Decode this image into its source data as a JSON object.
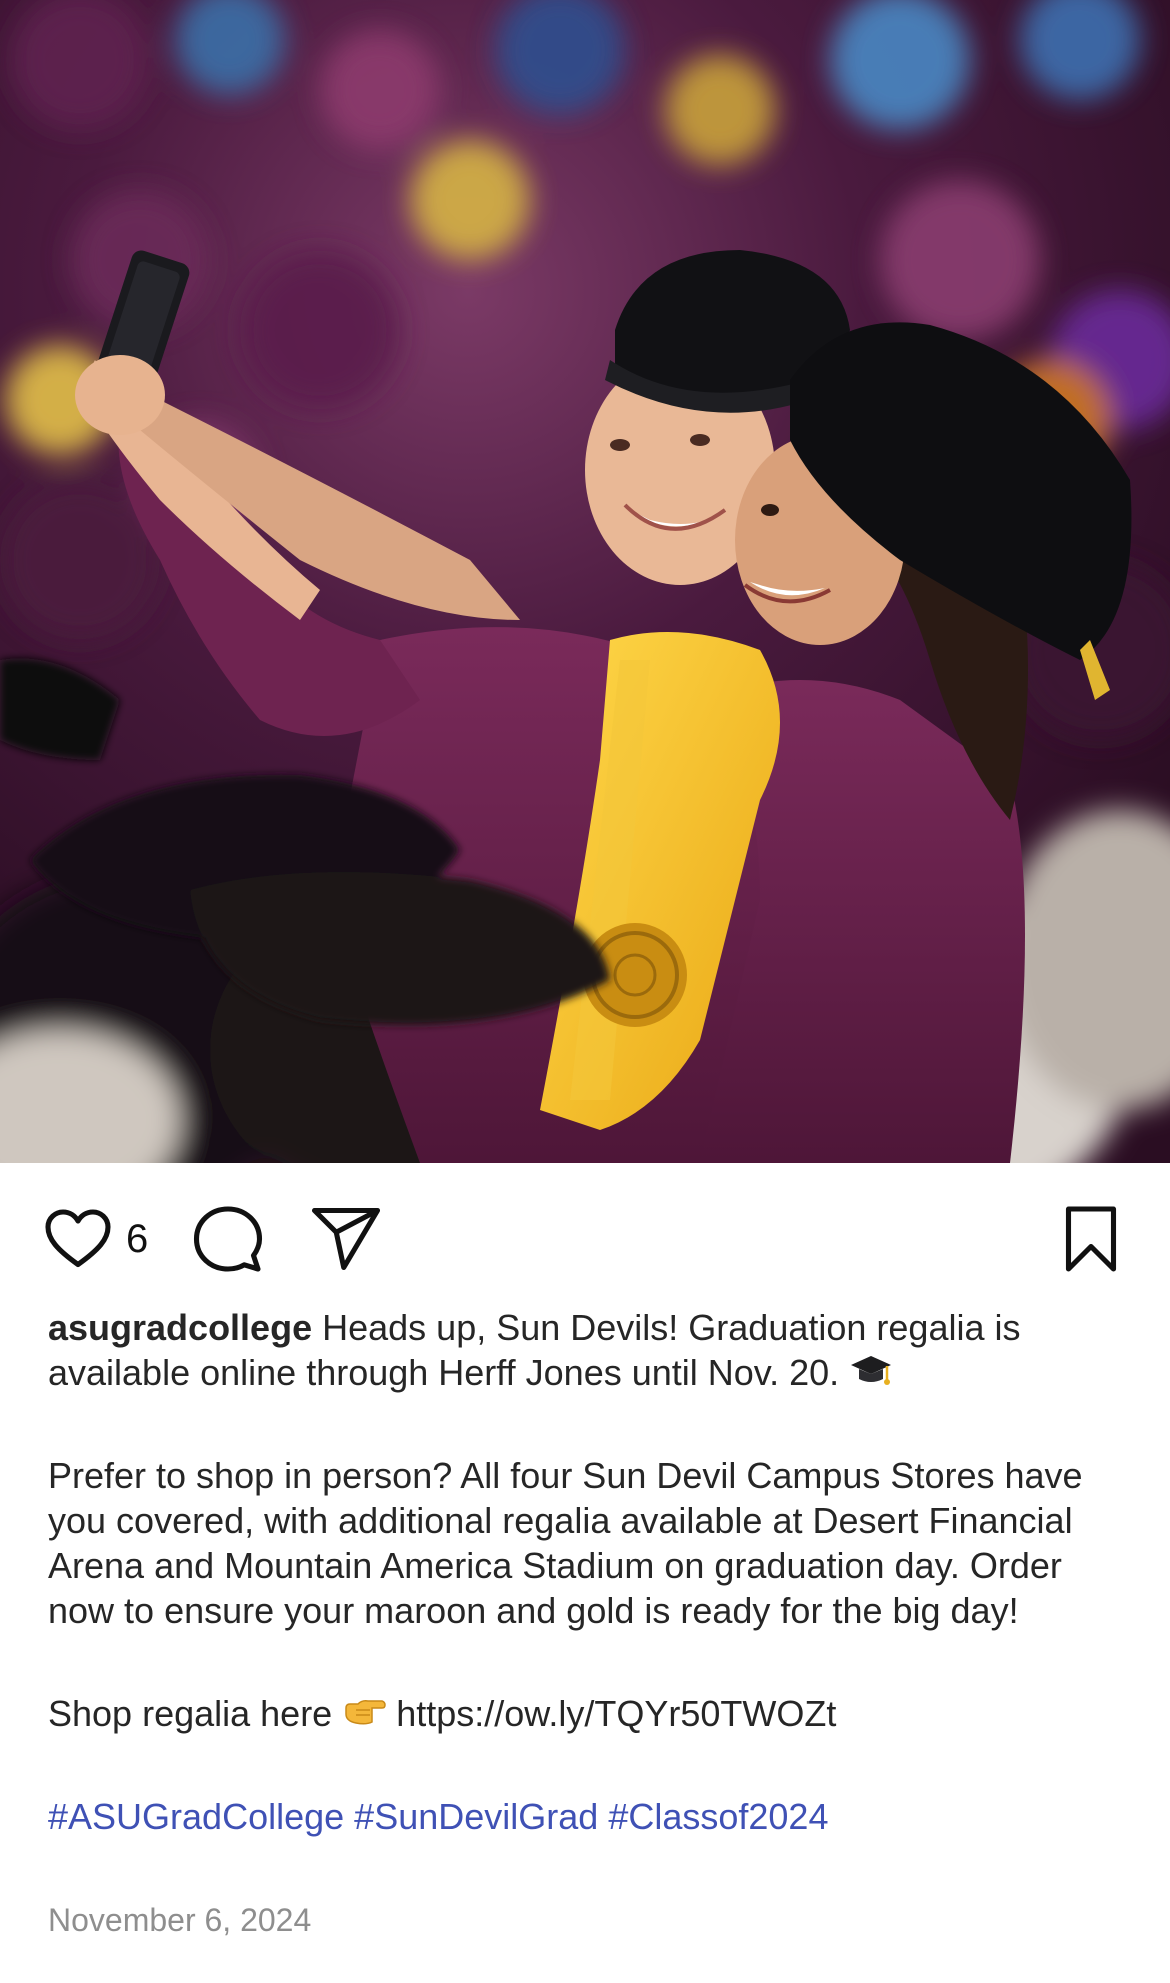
{
  "post": {
    "image_alt": "Two graduates in maroon gowns and black doctoral caps taking a selfie",
    "likes": "6",
    "username": "asugradcollege",
    "caption_line1": "Heads up, Sun Devils! Graduation regalia is available online through Herff Jones until Nov. 20.",
    "emoji_cap": "graduation-cap-emoji",
    "paragraph2": "Prefer to shop in person? All four Sun Devil Campus Stores have you covered, with additional regalia available at Desert Financial Arena and Mountain America Stadium on graduation day. Order now to ensure your maroon and gold is ready for the big day!",
    "shop_text": "Shop regalia here",
    "emoji_point": "backhand-index-pointing-right-emoji",
    "shop_link": "https://ow.ly/TQYr50TWOZt",
    "hashtags": [
      "#ASUGradCollege",
      "#SunDevilGrad",
      "#Classof2024"
    ],
    "date": "November 6, 2024"
  },
  "icons": {
    "like": "heart-icon",
    "comment": "comment-icon",
    "share": "share-icon",
    "save": "bookmark-icon"
  },
  "colors": {
    "hashtag": "#3f51b5",
    "date": "#8e8e8e",
    "maroon": "#7a2a5a",
    "gold": "#f5c518"
  }
}
